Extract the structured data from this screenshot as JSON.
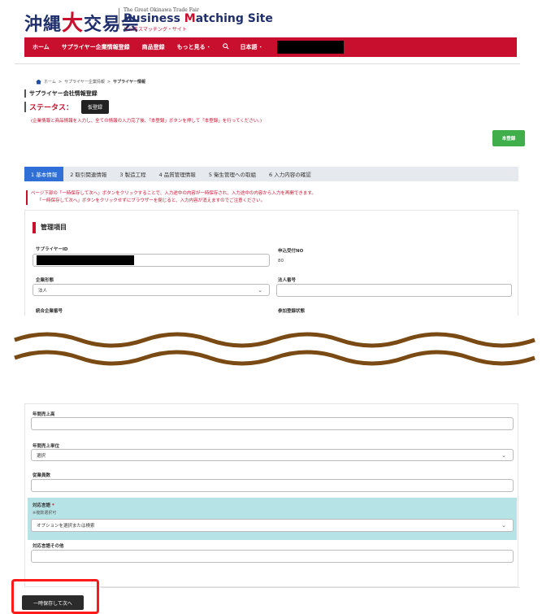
{
  "header": {
    "logo_jp_pre": "沖縄",
    "logo_jp_big": "大",
    "logo_jp_post": "交易会",
    "logo_en_small": "The Great Okinawa Trade Fair",
    "logo_en_main_1": "Business ",
    "logo_en_main_m": "M",
    "logo_en_main_2": "atching Site",
    "logo_en_sub": "ビジネスマッチング・サイト"
  },
  "nav": {
    "items": [
      "ホーム",
      "サプライヤー企業情報登録",
      "商品登録",
      "もっと見る ･"
    ],
    "language": "日本語 ･"
  },
  "breadcrumb": {
    "home": "ホーム",
    "sep": ">",
    "level1": "サプライヤー企業情報",
    "current": "サプライヤー情報"
  },
  "page": {
    "title": "サプライヤー会社情報登録",
    "status_label": "ステータス：",
    "status_value": "仮登録",
    "notice": "(企業情報と商品情報を入力し、全ての情報の入力完了後、「本登録」ボタンを押して「本登録」を行ってください。)",
    "register_button": "本登録"
  },
  "tabs": [
    {
      "label": "1 基本情報",
      "active": true
    },
    {
      "label": "2 取引関連情報",
      "active": false
    },
    {
      "label": "3 製造工程",
      "active": false
    },
    {
      "label": "4 品質管理情報",
      "active": false
    },
    {
      "label": "5 衛生管理への取組",
      "active": false
    },
    {
      "label": "6 入力内容の確認",
      "active": false
    }
  ],
  "warning": {
    "line1": "ページ下部の「一時保存して次へ」ボタンをクリックすることで、入力途中の内容が一時保存され、入力途中の内容から入力を再開できます。",
    "line2": "「一時保存して次へ」ボタンをクリックせずにブラウザーを閉じると、入力内容が消えますのでご注意ください。"
  },
  "section": {
    "title": "管理項目",
    "supplier_id_label": "サプライヤーID",
    "application_no_label": "申込受付NO",
    "application_no_value": "80",
    "company_type_label": "企業形態",
    "company_type_value": "法人",
    "corporate_number_label": "法人番号",
    "integrated_company_label": "統合企業番号",
    "participation_status_label": "参加登録状態"
  },
  "form_bottom": {
    "annual_sales_label": "年間売上高",
    "annual_sales_unit_label": "年間売上単位",
    "annual_sales_unit_value": "選択",
    "employees_label": "従業員数",
    "language_label": "対応言語",
    "language_required": "*",
    "language_hint": "※複数選択可",
    "language_placeholder": "オプションを選択または検索",
    "other_language_label": "対応言語その他",
    "save_next_button": "一時保存して次へ"
  },
  "colors": {
    "brand_red": "#c8102e",
    "tab_active": "#2f6fd6",
    "register_green": "#3fae4b",
    "language_bg": "#b6e3e6",
    "highlight_frame": "#ff1a1a"
  }
}
